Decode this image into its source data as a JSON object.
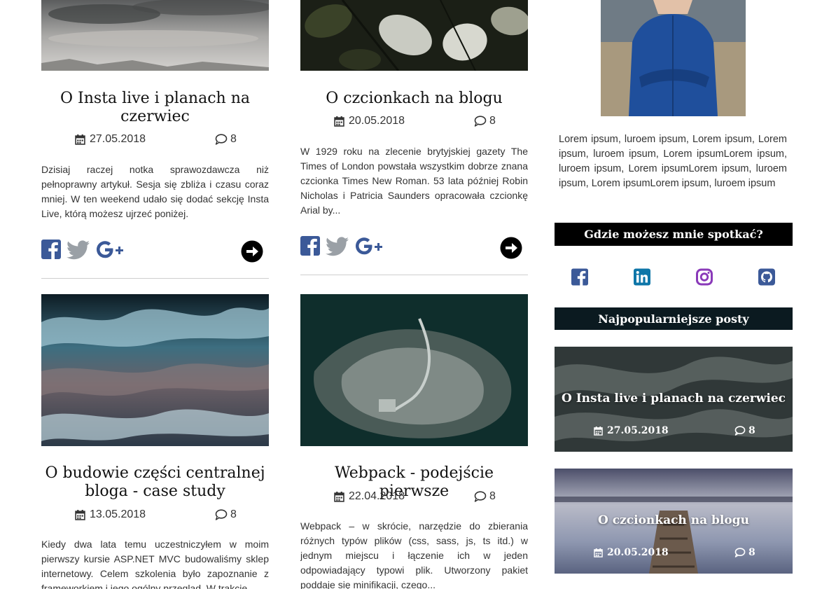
{
  "colors": {
    "facebook": "#3b5998",
    "twitter": "#9aa0a6",
    "google": "#3b5998",
    "linkedin": "#0e76a8",
    "instagram": "#8a3ab9",
    "github": "#3b5998",
    "section_head_dark": "#000000",
    "section_head_teal": "#0b1a20"
  },
  "posts": [
    {
      "title": "O Insta live i planach na czerwiec",
      "date": "27.05.2018",
      "comments": "8",
      "excerpt": "Dzisiaj raczej notka sprawozdawcza niż pełnoprawny artykuł. Sesja się zbliża i czasu coraz mniej. W ten weekend udało się dodać sekcję Insta Live, którą możesz ujrzeć poniżej."
    },
    {
      "title": "O czcionkach na blogu",
      "date": "20.05.2018",
      "comments": "8",
      "excerpt": "W 1929 roku na zlecenie brytyjskiej gazety The Times of London powstała wszystkim dobrze znana czcionka Times New Roman. 53 lata później Robin Nicholas i Patricia Saunders opracowała czcionkę Arial by..."
    },
    {
      "title": "O budowie części centralnej bloga - case study",
      "date": "13.05.2018",
      "comments": "8",
      "excerpt": "Kiedy dwa lata temu uczestniczyłem w moim pierwszy kursie ASP.NET MVC budowaliśmy sklep internetowy. Celem szkolenia było zapoznanie z frameworkiem i jego ogólny przegląd. W trakcie"
    },
    {
      "title": "Webpack - podejście pierwsze",
      "date": "22.04.2018",
      "comments": "8",
      "excerpt": "Webpack – w skrócie, narzędzie do zbierania różnych typów plików (css, sass, js, ts itd.) w jednym miejscu i łączenie ich w jeden odpowiadający typowi plik. Utworzony pakiet poddaje się minifikacji, czego..."
    }
  ],
  "sidebar": {
    "bio": "Lorem ipsum, luroem ipsum, Lorem ipsum, Lorem ipsum, luroem ipsum, Lorem ipsumLorem ipsum, luroem ipsum, Lorem ipsumLorem ipsum, luroem ipsum, Lorem ipsumLorem ipsum, luroem ipsum",
    "meet_heading": "Gdzie możesz mnie spotkać?",
    "popular_heading": "Najpopularniejsze posty",
    "popular": [
      {
        "title": "O Insta live i planach na czerwiec",
        "date": "27.05.2018",
        "comments": "8"
      },
      {
        "title": "O czcionkach na blogu",
        "date": "20.05.2018",
        "comments": "8"
      }
    ]
  }
}
